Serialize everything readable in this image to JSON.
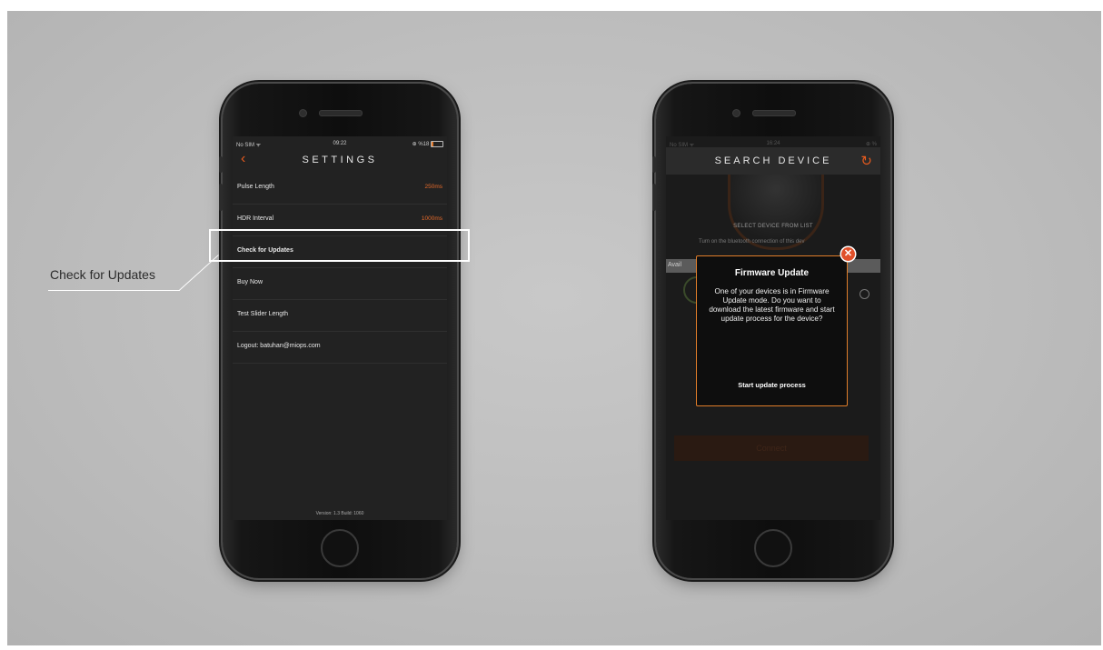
{
  "callout": {
    "label": "Check for Updates"
  },
  "phone1": {
    "status": {
      "carrier": "No SIM ᯤ",
      "time": "09:22",
      "battery": "⊕ %18",
      "battery_level_percent": 18
    },
    "header": {
      "title": "SETTINGS",
      "back_icon": "chevron-left-icon"
    },
    "rows": [
      {
        "label": "Pulse Length",
        "value": "250ms"
      },
      {
        "label": "HDR Interval",
        "value": "1000ms"
      },
      {
        "label": "Check for Updates",
        "value": ""
      },
      {
        "label": "Buy Now",
        "value": ""
      },
      {
        "label": "Test Slider Length",
        "value": ""
      },
      {
        "label": "Logout: batuhan@miops.com",
        "value": ""
      }
    ],
    "version": "Version: 1.3 Build: 1060"
  },
  "phone2": {
    "status": {
      "carrier": "No SIM ᯤ",
      "time": "16:24",
      "battery": "⊕ %"
    },
    "header": {
      "title": "SEARCH DEVICE",
      "refresh_icon": "refresh-icon"
    },
    "select_label": "SELECT DEVICE FROM LIST",
    "turn_on_text": "Turn on the bluetooth connection of this dev",
    "available_label": "Avail",
    "connect_label": "Connect",
    "modal": {
      "title": "Firmware Update",
      "body": "One of your devices is in Firmware Update mode. Do you want to download the latest firmware and start update process for the device?",
      "action": "Start update process",
      "close_icon": "close-icon"
    }
  },
  "colors": {
    "accent": "#e55a1e",
    "modal_border": "#e07d2a"
  }
}
